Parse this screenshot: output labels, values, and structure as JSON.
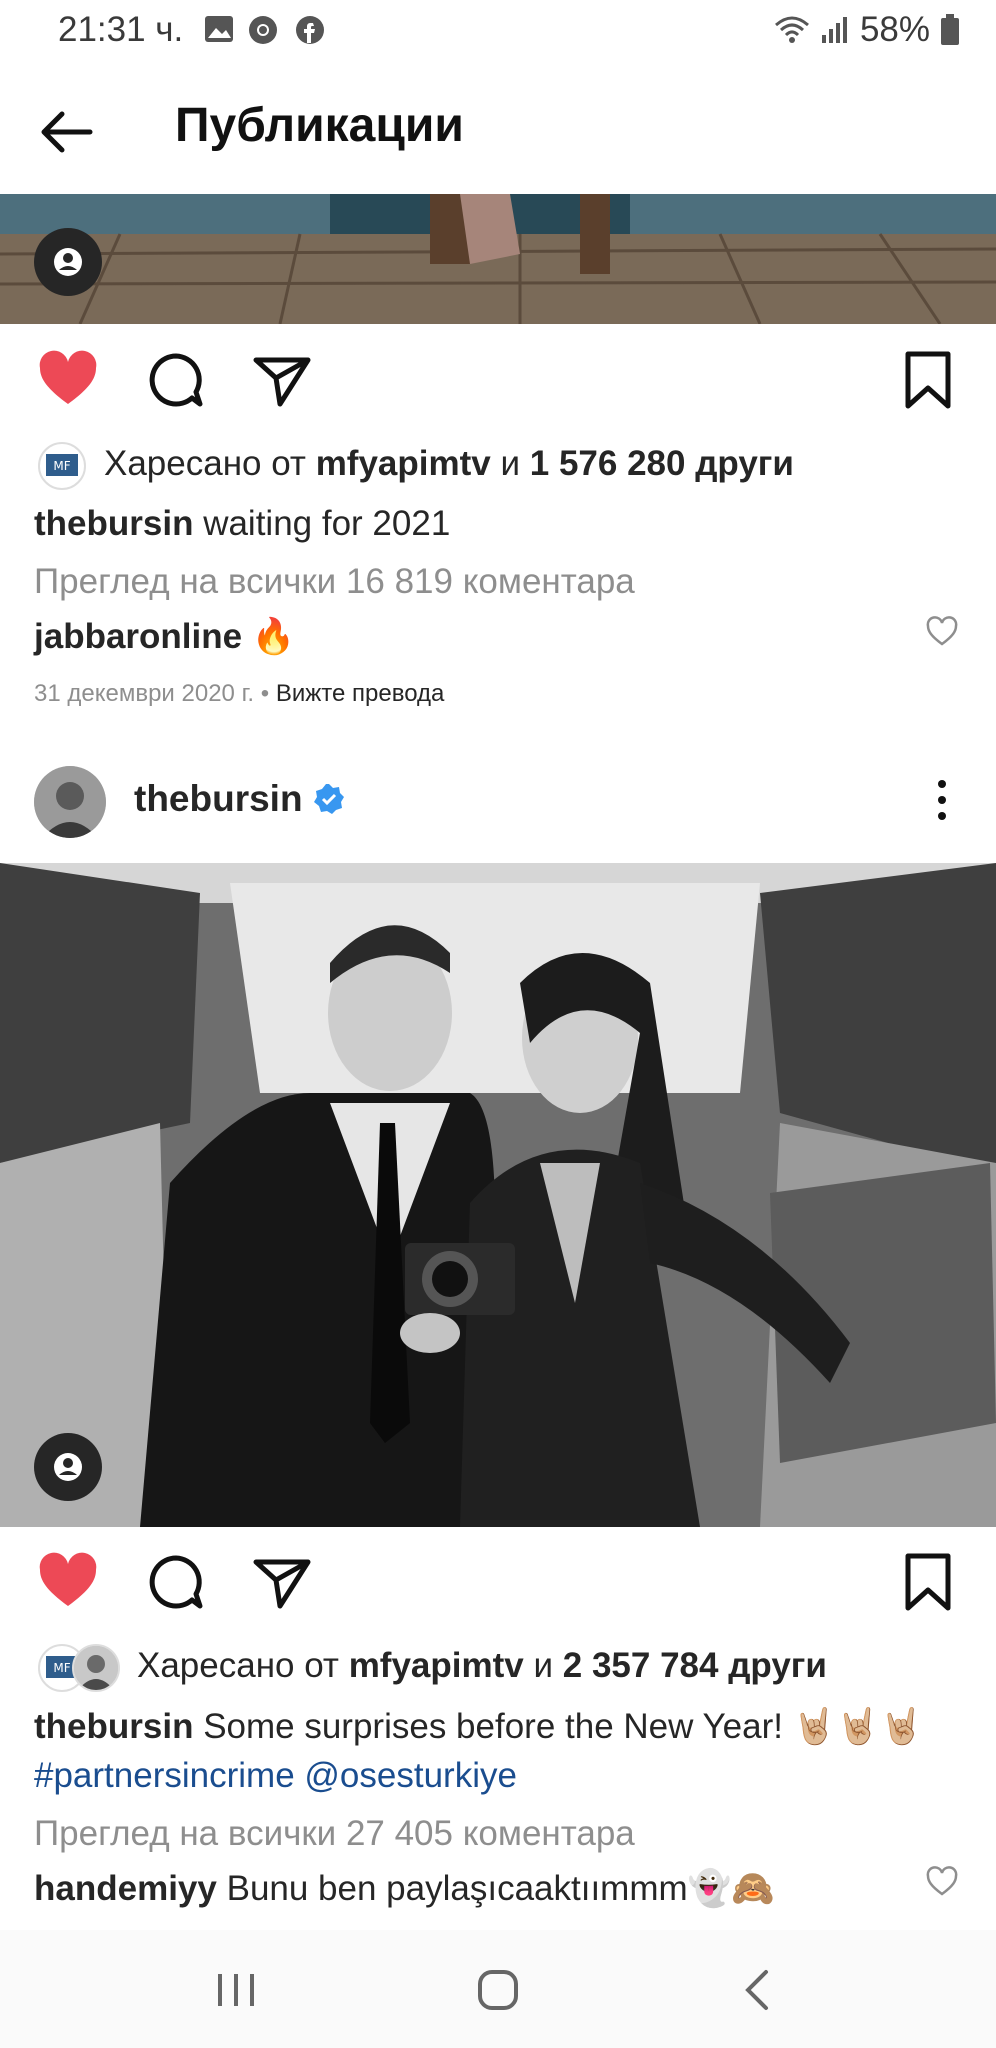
{
  "status_bar": {
    "time": "21:31 ч.",
    "battery": "58%"
  },
  "header": {
    "title": "Публикации"
  },
  "post1": {
    "liked_by_prefix": "Харесано от",
    "liked_by_user": "mfyapimtv",
    "liked_by_and": "и",
    "liked_by_count": "1 576 280 други",
    "author": "thebursin",
    "caption": "waiting for 2021",
    "view_comments": "Преглед на всички 16 819 коментара",
    "comment_user": "jabbaronline",
    "comment_text": "🔥",
    "date": "31 декември 2020 г.",
    "separator": "•",
    "translate": "Вижте превода"
  },
  "post2": {
    "author": "thebursin",
    "liked_by_prefix": "Харесано от",
    "liked_by_user": "mfyapimtv",
    "liked_by_and": "и",
    "liked_by_count": "2 357 784 други",
    "caption_author": "thebursin",
    "caption_text": "Some surprises before the New Year! 🤘🏼🤘🏼🤘🏼",
    "hashtag": "#partnersincrime",
    "mention": "@osesturkiye",
    "view_comments": "Преглед на всички 27 405 коментара",
    "comment_user": "handemiyy",
    "comment_text": "Bunu ben paylaşıcaaktıımmm👻🙈"
  },
  "icons": {
    "like": "heart-icon",
    "comment": "comment-icon",
    "share": "send-icon",
    "save": "bookmark-icon",
    "more": "more-vertical-icon",
    "verified": "verified-badge-icon"
  },
  "colors": {
    "like_red": "#ed4956",
    "verified_blue": "#3897f0",
    "link_blue": "#1a4d8f"
  }
}
